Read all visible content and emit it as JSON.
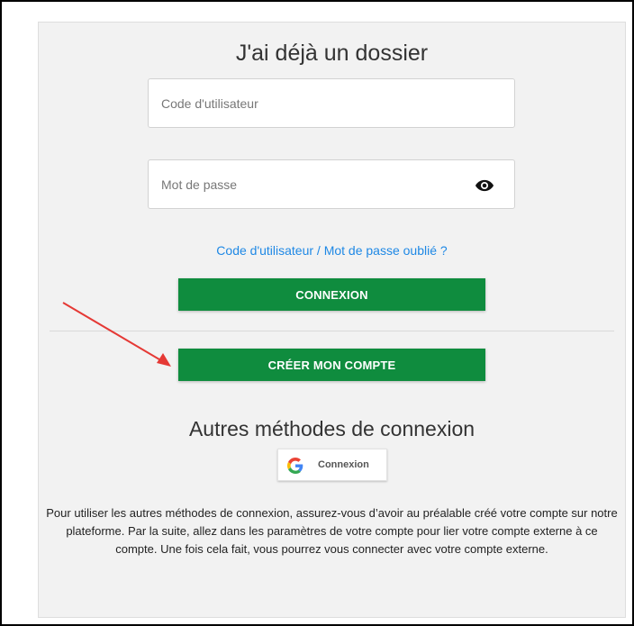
{
  "login": {
    "title": "J'ai déjà un dossier",
    "username_placeholder": "Code d'utilisateur",
    "password_placeholder": "Mot de passe",
    "forgot_link": "Code d'utilisateur / Mot de passe oublié ?",
    "connect_button": "CONNEXION",
    "create_account_button": "CRÉER MON COMPTE"
  },
  "other_methods": {
    "title": "Autres méthodes de connexion",
    "google_button": "Connexion",
    "info_text": "Pour utiliser les autres méthodes de connexion, assurez-vous d’avoir au préalable créé votre compte sur notre plateforme. Par la suite, allez dans les paramètres de votre compte pour lier votre compte externe à ce compte. Une fois cela fait, vous pourrez vous connecter avec votre compte externe."
  },
  "icons": {
    "password_toggle": "eye-icon",
    "google": "google-icon",
    "annotation": "red-arrow"
  },
  "colors": {
    "primary_button": "#0f8c3e",
    "link": "#1e88e5",
    "panel_bg": "#f2f2f2",
    "annotation_arrow": "#e53935"
  }
}
